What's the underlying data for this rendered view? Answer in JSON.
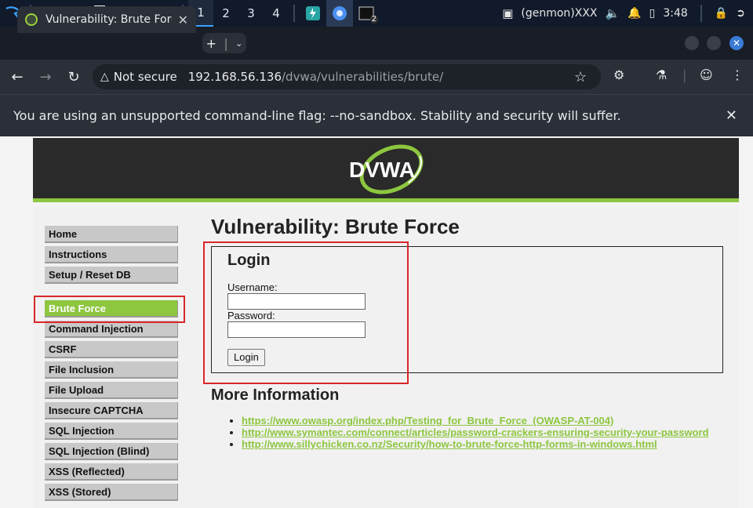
{
  "taskbar": {
    "workspaces": [
      "1",
      "2",
      "3",
      "4"
    ],
    "tray_user": "(genmon)XXX",
    "clock": "3:48",
    "terminal_badge": "2"
  },
  "browser": {
    "tab_title": "Vulnerability: Brute Force",
    "not_secure_label": "Not secure",
    "url_host": "192.168.56.136",
    "url_path": "/dvwa/vulnerabilities/brute/",
    "infobar_message": "You are using an unsupported command-line flag: --no-sandbox. Stability and security will suffer."
  },
  "dvwa": {
    "logo_text": "DVWA",
    "accent_color": "#8dc63f",
    "menu_top": [
      "Home",
      "Instructions",
      "Setup / Reset DB"
    ],
    "menu_vulns": [
      "Brute Force",
      "Command Injection",
      "CSRF",
      "File Inclusion",
      "File Upload",
      "Insecure CAPTCHA",
      "SQL Injection",
      "SQL Injection (Blind)",
      "XSS (Reflected)",
      "XSS (Stored)"
    ],
    "page_title": "Vulnerability: Brute Force",
    "login": {
      "heading": "Login",
      "username_label": "Username:",
      "password_label": "Password:",
      "button": "Login"
    },
    "more_info_heading": "More Information",
    "links": [
      "https://www.owasp.org/index.php/Testing_for_Brute_Force_(OWASP-AT-004)",
      "http://www.symantec.com/connect/articles/password-crackers-ensuring-security-your-password",
      "http://www.sillychicken.co.nz/Security/how-to-brute-force-http-forms-in-windows.html"
    ]
  }
}
